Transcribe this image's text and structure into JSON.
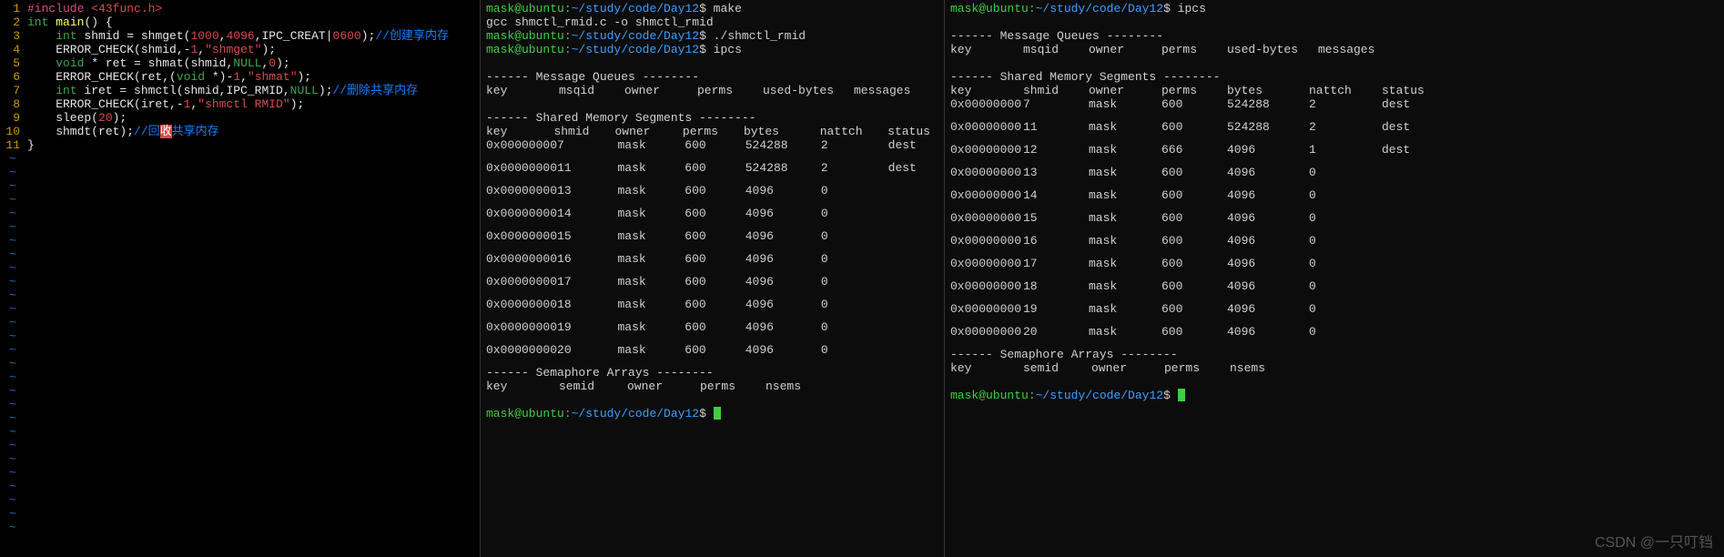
{
  "editor": {
    "lines": [
      {
        "n": 1,
        "tokens": [
          [
            "hl-pp",
            "#include"
          ],
          [
            "hl-id",
            " "
          ],
          [
            "hl-hdr",
            "<43func.h>"
          ]
        ]
      },
      {
        "n": 2,
        "tokens": [
          [
            "hl-type",
            "int"
          ],
          [
            "hl-id",
            " "
          ],
          [
            "hl-yel",
            "main"
          ],
          [
            "hl-id",
            "() {"
          ]
        ]
      },
      {
        "n": 3,
        "tokens": [
          [
            "hl-id",
            "    "
          ],
          [
            "hl-type",
            "int"
          ],
          [
            "hl-id",
            " shmid = shmget("
          ],
          [
            "hl-num",
            "1000"
          ],
          [
            "hl-id",
            ","
          ],
          [
            "hl-num",
            "4096"
          ],
          [
            "hl-id",
            ",IPC_CREAT|"
          ],
          [
            "hl-num",
            "0600"
          ],
          [
            "hl-id",
            ");"
          ],
          [
            "hl-cmt",
            "//创建享内存"
          ]
        ]
      },
      {
        "n": 4,
        "tokens": [
          [
            "hl-id",
            "    ERROR_CHECK(shmid,-"
          ],
          [
            "hl-num",
            "1"
          ],
          [
            "hl-id",
            ","
          ],
          [
            "hl-str",
            "\"shmget\""
          ],
          [
            "hl-id",
            ");"
          ]
        ]
      },
      {
        "n": 5,
        "tokens": [
          [
            "hl-id",
            "    "
          ],
          [
            "hl-type",
            "void"
          ],
          [
            "hl-id",
            " * ret = shmat(shmid,"
          ],
          [
            "hl-type",
            "NULL"
          ],
          [
            "hl-id",
            ","
          ],
          [
            "hl-num",
            "0"
          ],
          [
            "hl-id",
            ");"
          ]
        ]
      },
      {
        "n": 6,
        "tokens": [
          [
            "hl-id",
            "    ERROR_CHECK(ret,("
          ],
          [
            "hl-type",
            "void"
          ],
          [
            "hl-id",
            " *)-"
          ],
          [
            "hl-num",
            "1"
          ],
          [
            "hl-id",
            ","
          ],
          [
            "hl-str",
            "\"shmat\""
          ],
          [
            "hl-id",
            ");"
          ]
        ]
      },
      {
        "n": 7,
        "tokens": [
          [
            "hl-id",
            "    "
          ],
          [
            "hl-type",
            "int"
          ],
          [
            "hl-id",
            " iret = shmctl(shmid,IPC_RMID,"
          ],
          [
            "hl-type",
            "NULL"
          ],
          [
            "hl-id",
            ");"
          ],
          [
            "hl-cmt",
            "//删除共享内存"
          ]
        ]
      },
      {
        "n": 8,
        "tokens": [
          [
            "hl-id",
            "    ERROR_CHECK(iret,-"
          ],
          [
            "hl-num",
            "1"
          ],
          [
            "hl-id",
            ","
          ],
          [
            "hl-str",
            "\"shmctl RMID\""
          ],
          [
            "hl-id",
            ");"
          ]
        ]
      },
      {
        "n": 9,
        "tokens": [
          [
            "hl-id",
            "    sleep("
          ],
          [
            "hl-num",
            "20"
          ],
          [
            "hl-id",
            ");"
          ]
        ]
      },
      {
        "n": 10,
        "tokens": [
          [
            "hl-id",
            "    shmdt(ret);"
          ],
          [
            "hl-cmt",
            "//回"
          ],
          [
            "hl-bad",
            "收"
          ],
          [
            "hl-cmt",
            "共享内存"
          ]
        ]
      },
      {
        "n": 11,
        "tokens": [
          [
            "hl-id",
            "}"
          ]
        ]
      }
    ]
  },
  "term2": {
    "cmds": [
      {
        "prompt": "mask@ubuntu:",
        "path": "~/study/code/Day12",
        "sep": "$ ",
        "cmd": "make"
      },
      {
        "plain": "gcc shmctl_rmid.c -o shmctl_rmid"
      },
      {
        "prompt": "mask@ubuntu:",
        "path": "~/study/code/Day12",
        "sep": "$ ",
        "cmd": "./shmctl_rmid"
      },
      {
        "prompt": "mask@ubuntu:",
        "path": "~/study/code/Day12",
        "sep": "$ ",
        "cmd": "ipcs"
      }
    ],
    "msg_header": "------ Message Queues --------",
    "msg_cols": [
      "key",
      "msqid",
      "owner",
      "perms",
      "used-bytes",
      "messages"
    ],
    "shm_header": "------ Shared Memory Segments --------",
    "shm_cols": [
      "key",
      "shmid",
      "owner",
      "perms",
      "bytes",
      "nattch",
      "status"
    ],
    "shm_rows": [
      [
        "0x00000000",
        "7",
        "mask",
        "600",
        "524288",
        "2",
        "dest"
      ],
      [
        "0x00000000",
        "11",
        "mask",
        "600",
        "524288",
        "2",
        "dest"
      ],
      [
        "0x00000000",
        "13",
        "mask",
        "600",
        "4096",
        "0",
        ""
      ],
      [
        "0x00000000",
        "14",
        "mask",
        "600",
        "4096",
        "0",
        ""
      ],
      [
        "0x00000000",
        "15",
        "mask",
        "600",
        "4096",
        "0",
        ""
      ],
      [
        "0x00000000",
        "16",
        "mask",
        "600",
        "4096",
        "0",
        ""
      ],
      [
        "0x00000000",
        "17",
        "mask",
        "600",
        "4096",
        "0",
        ""
      ],
      [
        "0x00000000",
        "18",
        "mask",
        "600",
        "4096",
        "0",
        ""
      ],
      [
        "0x00000000",
        "19",
        "mask",
        "600",
        "4096",
        "0",
        ""
      ],
      [
        "0x00000000",
        "20",
        "mask",
        "600",
        "4096",
        "0",
        ""
      ]
    ],
    "sem_header": "------ Semaphore Arrays --------",
    "sem_cols": [
      "key",
      "semid",
      "owner",
      "perms",
      "nsems"
    ],
    "final_prompt": {
      "prompt": "mask@ubuntu:",
      "path": "~/study/code/Day12",
      "sep": "$ "
    }
  },
  "term3": {
    "cmds": [
      {
        "prompt": "mask@ubuntu:",
        "path": "~/study/code/Day12",
        "sep": "$ ",
        "cmd": "ipcs"
      }
    ],
    "msg_header": "------ Message Queues --------",
    "msg_cols": [
      "key",
      "msqid",
      "owner",
      "perms",
      "used-bytes",
      "messages"
    ],
    "shm_header": "------ Shared Memory Segments --------",
    "shm_cols": [
      "key",
      "shmid",
      "owner",
      "perms",
      "bytes",
      "nattch",
      "status"
    ],
    "shm_rows": [
      [
        "0x00000000",
        "7",
        "mask",
        "600",
        "524288",
        "2",
        "dest"
      ],
      [
        "0x00000000",
        "11",
        "mask",
        "600",
        "524288",
        "2",
        "dest"
      ],
      [
        "0x00000000",
        "12",
        "mask",
        "666",
        "4096",
        "1",
        "dest"
      ],
      [
        "0x00000000",
        "13",
        "mask",
        "600",
        "4096",
        "0",
        ""
      ],
      [
        "0x00000000",
        "14",
        "mask",
        "600",
        "4096",
        "0",
        ""
      ],
      [
        "0x00000000",
        "15",
        "mask",
        "600",
        "4096",
        "0",
        ""
      ],
      [
        "0x00000000",
        "16",
        "mask",
        "600",
        "4096",
        "0",
        ""
      ],
      [
        "0x00000000",
        "17",
        "mask",
        "600",
        "4096",
        "0",
        ""
      ],
      [
        "0x00000000",
        "18",
        "mask",
        "600",
        "4096",
        "0",
        ""
      ],
      [
        "0x00000000",
        "19",
        "mask",
        "600",
        "4096",
        "0",
        ""
      ],
      [
        "0x00000000",
        "20",
        "mask",
        "600",
        "4096",
        "0",
        ""
      ]
    ],
    "sem_header": "------ Semaphore Arrays --------",
    "sem_cols": [
      "key",
      "semid",
      "owner",
      "perms",
      "nsems"
    ],
    "final_prompt": {
      "prompt": "mask@ubuntu:",
      "path": "~/study/code/Day12",
      "sep": "$ "
    }
  },
  "watermark": "CSDN @一只叮铛"
}
